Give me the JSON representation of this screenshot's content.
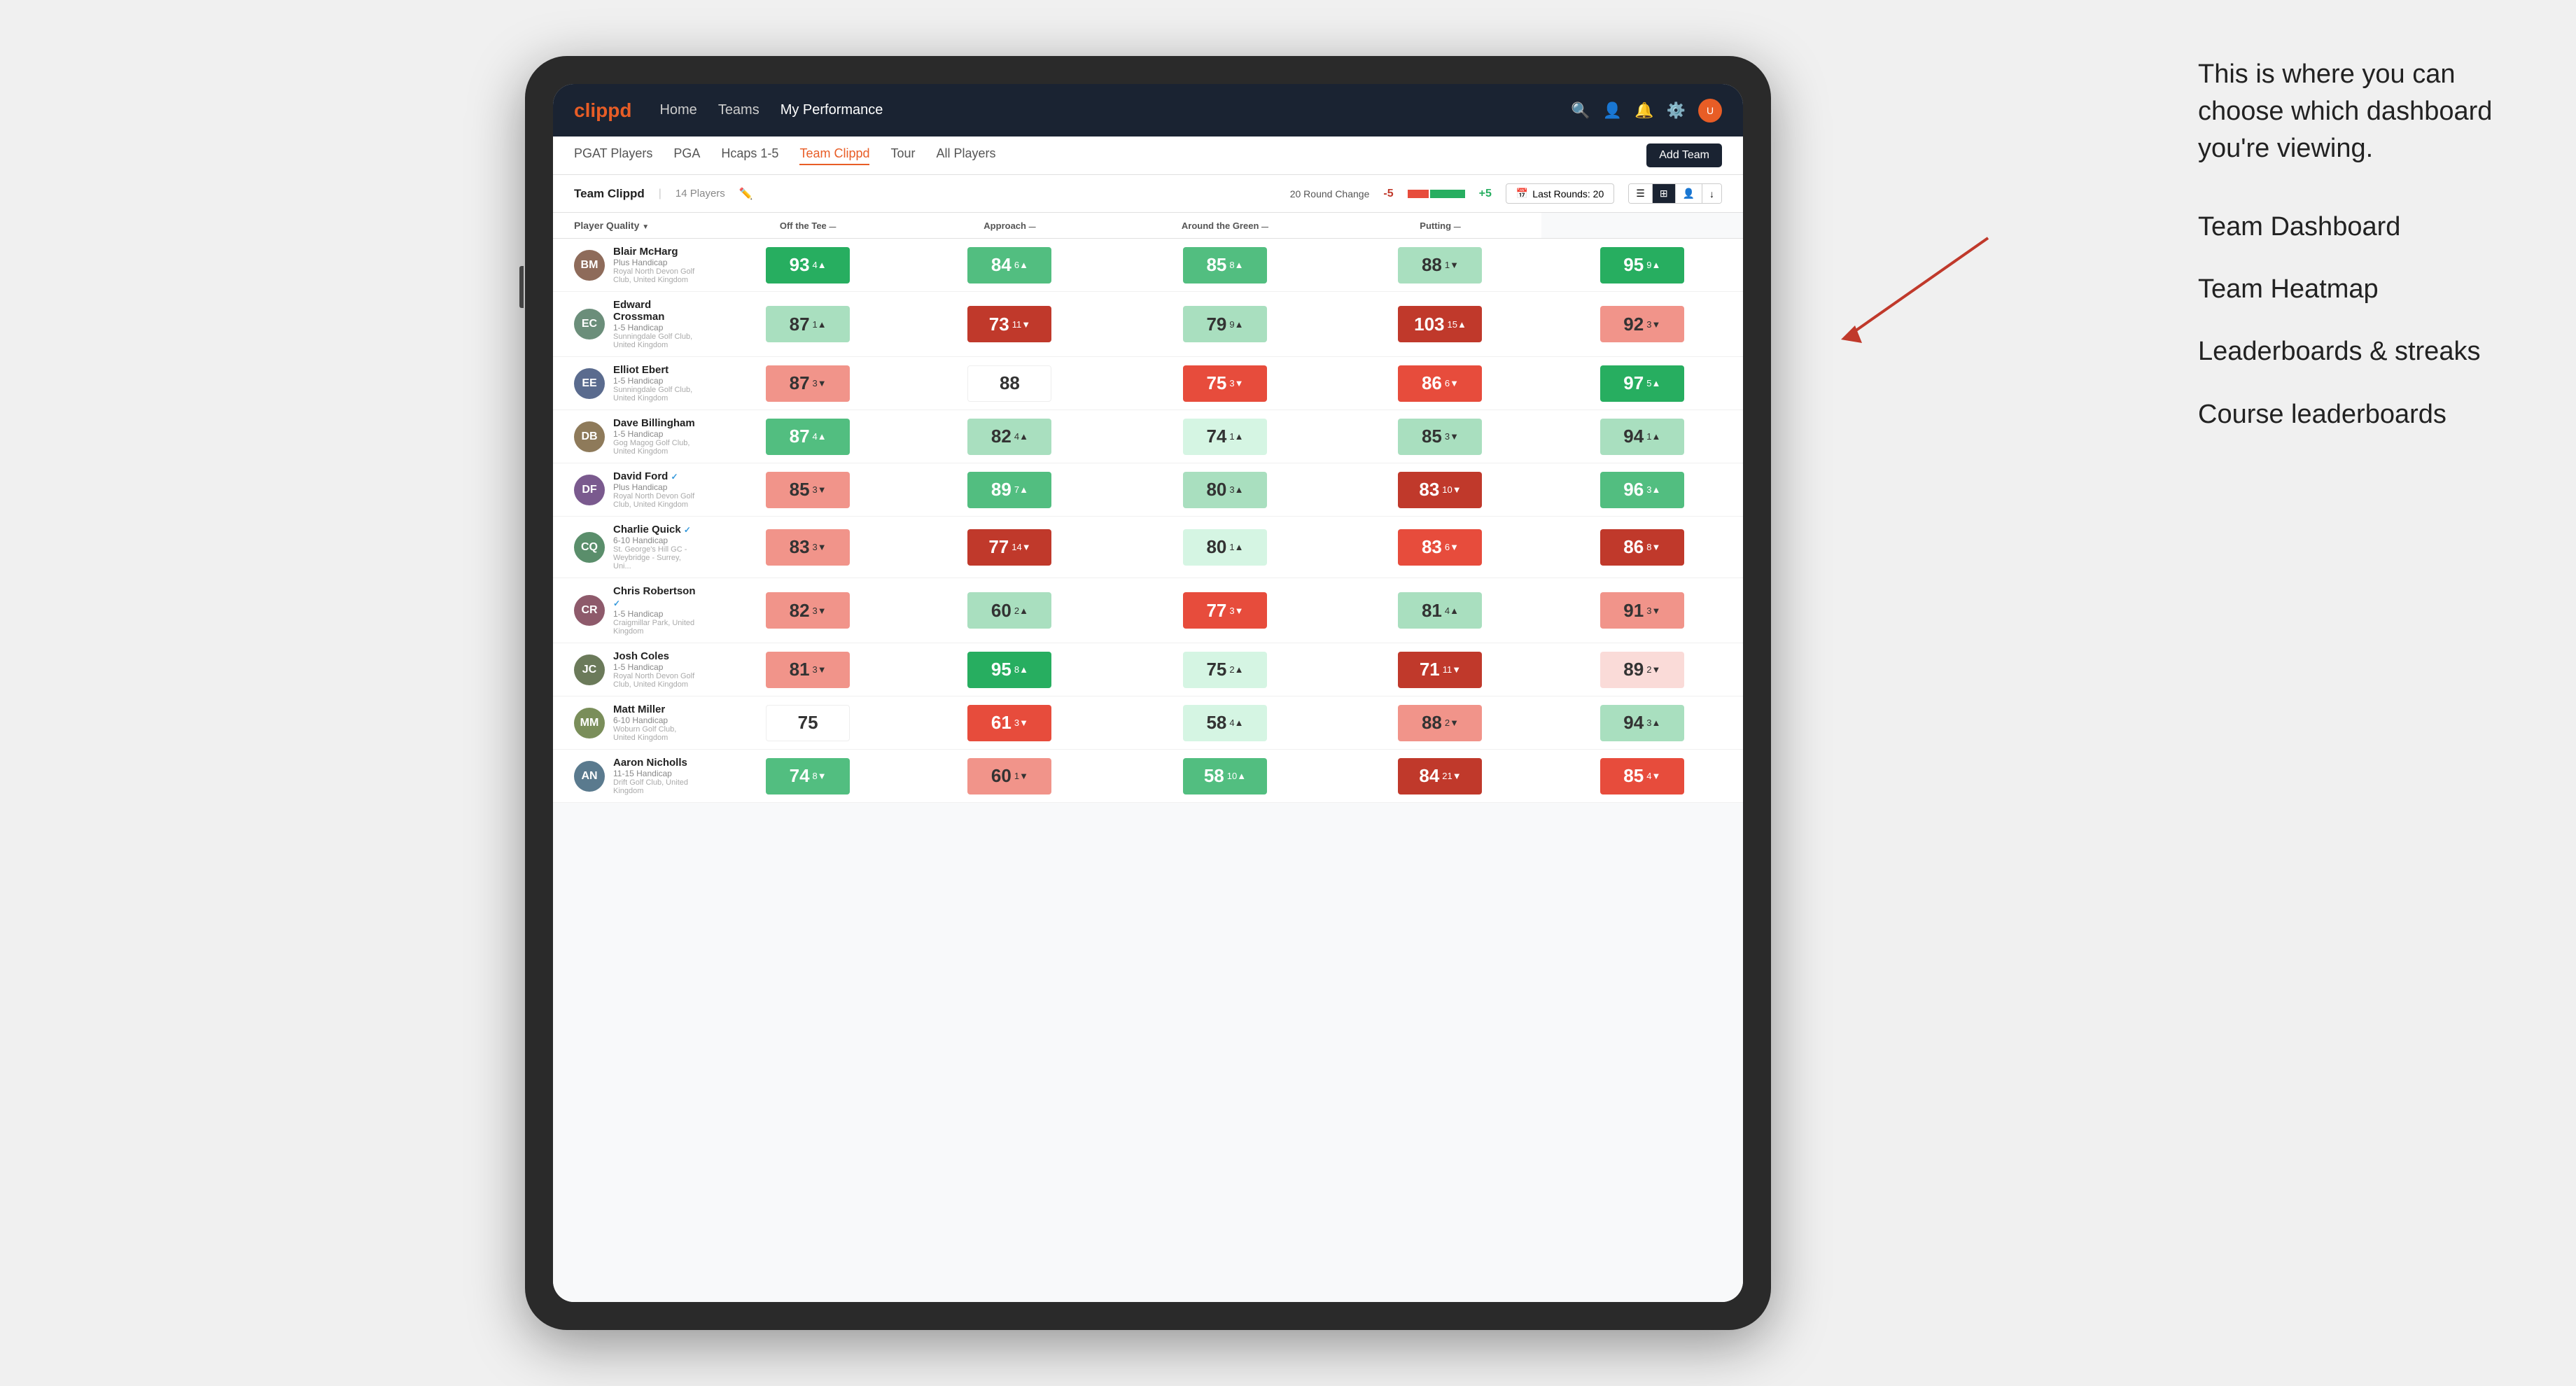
{
  "annotation": {
    "intro": "This is where you can choose which dashboard you're viewing.",
    "items": [
      "Team Dashboard",
      "Team Heatmap",
      "Leaderboards & streaks",
      "Course leaderboards"
    ]
  },
  "nav": {
    "logo": "clippd",
    "items": [
      "Home",
      "Teams",
      "My Performance"
    ],
    "active": "My Performance"
  },
  "sub_nav": {
    "items": [
      "PGAT Players",
      "PGA",
      "Hcaps 1-5",
      "Team Clippd",
      "Tour",
      "All Players"
    ],
    "active": "Team Clippd",
    "add_team": "Add Team"
  },
  "team_header": {
    "name": "Team Clippd",
    "separator": "|",
    "count": "14 Players",
    "round_change_label": "20 Round Change",
    "change_neg": "-5",
    "change_pos": "+5",
    "last_rounds": "Last Rounds: 20"
  },
  "columns": {
    "player_quality": "Player Quality",
    "off_tee": "Off the Tee",
    "approach": "Approach",
    "around_green": "Around the Green",
    "putting": "Putting"
  },
  "players": [
    {
      "name": "Blair McHarg",
      "handicap": "Plus Handicap",
      "club": "Royal North Devon Golf Club, United Kingdom",
      "initials": "BM",
      "scores": {
        "quality": {
          "val": 93,
          "change": "4",
          "dir": "up",
          "color": "green-dark"
        },
        "tee": {
          "val": 84,
          "change": "6",
          "dir": "up",
          "color": "green-mid"
        },
        "approach": {
          "val": 85,
          "change": "8",
          "dir": "up",
          "color": "green-mid"
        },
        "around": {
          "val": 88,
          "change": "1",
          "dir": "down",
          "color": "green-light"
        },
        "putting": {
          "val": 95,
          "change": "9",
          "dir": "up",
          "color": "green-dark"
        }
      }
    },
    {
      "name": "Edward Crossman",
      "handicap": "1-5 Handicap",
      "club": "Sunningdale Golf Club, United Kingdom",
      "initials": "EC",
      "scores": {
        "quality": {
          "val": 87,
          "change": "1",
          "dir": "up",
          "color": "green-light"
        },
        "tee": {
          "val": 73,
          "change": "11",
          "dir": "down",
          "color": "red-dark"
        },
        "approach": {
          "val": 79,
          "change": "9",
          "dir": "up",
          "color": "green-light"
        },
        "around": {
          "val": 103,
          "change": "15",
          "dir": "up",
          "color": "red-dark"
        },
        "putting": {
          "val": 92,
          "change": "3",
          "dir": "down",
          "color": "red-light"
        }
      }
    },
    {
      "name": "Elliot Ebert",
      "handicap": "1-5 Handicap",
      "club": "Sunningdale Golf Club, United Kingdom",
      "initials": "EE",
      "scores": {
        "quality": {
          "val": 87,
          "change": "3",
          "dir": "down",
          "color": "red-light"
        },
        "tee": {
          "val": 88,
          "change": "",
          "dir": "",
          "color": "white"
        },
        "approach": {
          "val": 75,
          "change": "3",
          "dir": "down",
          "color": "red-mid"
        },
        "around": {
          "val": 86,
          "change": "6",
          "dir": "down",
          "color": "red-mid"
        },
        "putting": {
          "val": 97,
          "change": "5",
          "dir": "up",
          "color": "green-dark"
        }
      }
    },
    {
      "name": "Dave Billingham",
      "handicap": "1-5 Handicap",
      "club": "Gog Magog Golf Club, United Kingdom",
      "initials": "DB",
      "scores": {
        "quality": {
          "val": 87,
          "change": "4",
          "dir": "up",
          "color": "green-mid"
        },
        "tee": {
          "val": 82,
          "change": "4",
          "dir": "up",
          "color": "green-light"
        },
        "approach": {
          "val": 74,
          "change": "1",
          "dir": "up",
          "color": "green-pale"
        },
        "around": {
          "val": 85,
          "change": "3",
          "dir": "down",
          "color": "green-light"
        },
        "putting": {
          "val": 94,
          "change": "1",
          "dir": "up",
          "color": "green-light"
        }
      }
    },
    {
      "name": "David Ford",
      "handicap": "Plus Handicap",
      "club": "Royal North Devon Golf Club, United Kingdom",
      "initials": "DF",
      "verified": true,
      "scores": {
        "quality": {
          "val": 85,
          "change": "3",
          "dir": "down",
          "color": "red-light"
        },
        "tee": {
          "val": 89,
          "change": "7",
          "dir": "up",
          "color": "green-mid"
        },
        "approach": {
          "val": 80,
          "change": "3",
          "dir": "up",
          "color": "green-light"
        },
        "around": {
          "val": 83,
          "change": "10",
          "dir": "down",
          "color": "red-dark"
        },
        "putting": {
          "val": 96,
          "change": "3",
          "dir": "up",
          "color": "green-mid"
        }
      }
    },
    {
      "name": "Charlie Quick",
      "handicap": "6-10 Handicap",
      "club": "St. George's Hill GC - Weybridge - Surrey, Uni...",
      "initials": "CQ",
      "verified": true,
      "scores": {
        "quality": {
          "val": 83,
          "change": "3",
          "dir": "down",
          "color": "red-light"
        },
        "tee": {
          "val": 77,
          "change": "14",
          "dir": "down",
          "color": "red-dark"
        },
        "approach": {
          "val": 80,
          "change": "1",
          "dir": "up",
          "color": "green-pale"
        },
        "around": {
          "val": 83,
          "change": "6",
          "dir": "down",
          "color": "red-mid"
        },
        "putting": {
          "val": 86,
          "change": "8",
          "dir": "down",
          "color": "red-dark"
        }
      }
    },
    {
      "name": "Chris Robertson",
      "handicap": "1-5 Handicap",
      "club": "Craigmillar Park, United Kingdom",
      "initials": "CR",
      "verified": true,
      "scores": {
        "quality": {
          "val": 82,
          "change": "3",
          "dir": "down",
          "color": "red-light"
        },
        "tee": {
          "val": 60,
          "change": "2",
          "dir": "up",
          "color": "green-light"
        },
        "approach": {
          "val": 77,
          "change": "3",
          "dir": "down",
          "color": "red-mid"
        },
        "around": {
          "val": 81,
          "change": "4",
          "dir": "up",
          "color": "green-light"
        },
        "putting": {
          "val": 91,
          "change": "3",
          "dir": "down",
          "color": "red-light"
        }
      }
    },
    {
      "name": "Josh Coles",
      "handicap": "1-5 Handicap",
      "club": "Royal North Devon Golf Club, United Kingdom",
      "initials": "JC",
      "scores": {
        "quality": {
          "val": 81,
          "change": "3",
          "dir": "down",
          "color": "red-light"
        },
        "tee": {
          "val": 95,
          "change": "8",
          "dir": "up",
          "color": "green-dark"
        },
        "approach": {
          "val": 75,
          "change": "2",
          "dir": "up",
          "color": "green-pale"
        },
        "around": {
          "val": 71,
          "change": "11",
          "dir": "down",
          "color": "red-dark"
        },
        "putting": {
          "val": 89,
          "change": "2",
          "dir": "down",
          "color": "red-pale"
        }
      }
    },
    {
      "name": "Matt Miller",
      "handicap": "6-10 Handicap",
      "club": "Woburn Golf Club, United Kingdom",
      "initials": "MM",
      "scores": {
        "quality": {
          "val": 75,
          "change": "",
          "dir": "",
          "color": "white"
        },
        "tee": {
          "val": 61,
          "change": "3",
          "dir": "down",
          "color": "red-mid"
        },
        "approach": {
          "val": 58,
          "change": "4",
          "dir": "up",
          "color": "green-pale"
        },
        "around": {
          "val": 88,
          "change": "2",
          "dir": "down",
          "color": "red-light"
        },
        "putting": {
          "val": 94,
          "change": "3",
          "dir": "up",
          "color": "green-light"
        }
      }
    },
    {
      "name": "Aaron Nicholls",
      "handicap": "11-15 Handicap",
      "club": "Drift Golf Club, United Kingdom",
      "initials": "AN",
      "scores": {
        "quality": {
          "val": 74,
          "change": "8",
          "dir": "down",
          "color": "green-mid"
        },
        "tee": {
          "val": 60,
          "change": "1",
          "dir": "down",
          "color": "red-light"
        },
        "approach": {
          "val": 58,
          "change": "10",
          "dir": "up",
          "color": "green-mid"
        },
        "around": {
          "val": 84,
          "change": "21",
          "dir": "down",
          "color": "red-dark"
        },
        "putting": {
          "val": 85,
          "change": "4",
          "dir": "down",
          "color": "red-mid"
        }
      }
    }
  ]
}
